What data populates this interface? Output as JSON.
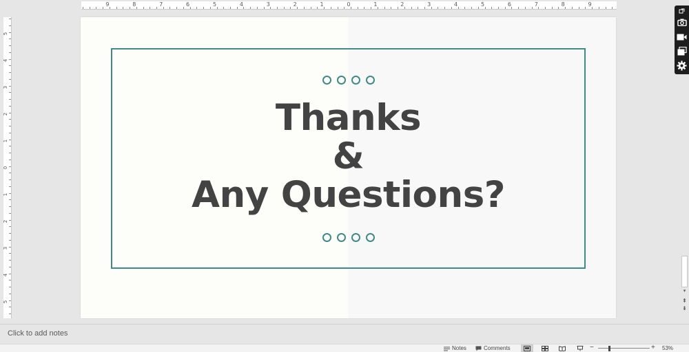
{
  "ruler": {
    "horizontal_labels": [
      "9",
      "8",
      "7",
      "6",
      "5",
      "4",
      "3",
      "2",
      "1",
      "0",
      "1",
      "2",
      "3",
      "4",
      "5",
      "6",
      "7",
      "8",
      "9"
    ],
    "vertical_labels": [
      "5",
      "4",
      "3",
      "2",
      "1",
      "0",
      "1",
      "2",
      "3",
      "4",
      "5"
    ]
  },
  "slide": {
    "title_lines": [
      "Thanks",
      "&",
      "Any Questions?"
    ],
    "accent_color": "#3e8a86",
    "text_color": "#434343"
  },
  "notes": {
    "placeholder": "Click to add notes"
  },
  "statusbar": {
    "notes_label": "Notes",
    "comments_label": "Comments",
    "zoom_level": "53%",
    "zoom_out": "−",
    "zoom_in": "+"
  },
  "icons": {
    "toolbar": [
      "pop-out-icon",
      "camera-icon",
      "video-camera-icon",
      "slides-icon",
      "gear-icon"
    ],
    "scroll_down": "▾",
    "prev_slide": "⇞",
    "next_slide": "⇟"
  }
}
